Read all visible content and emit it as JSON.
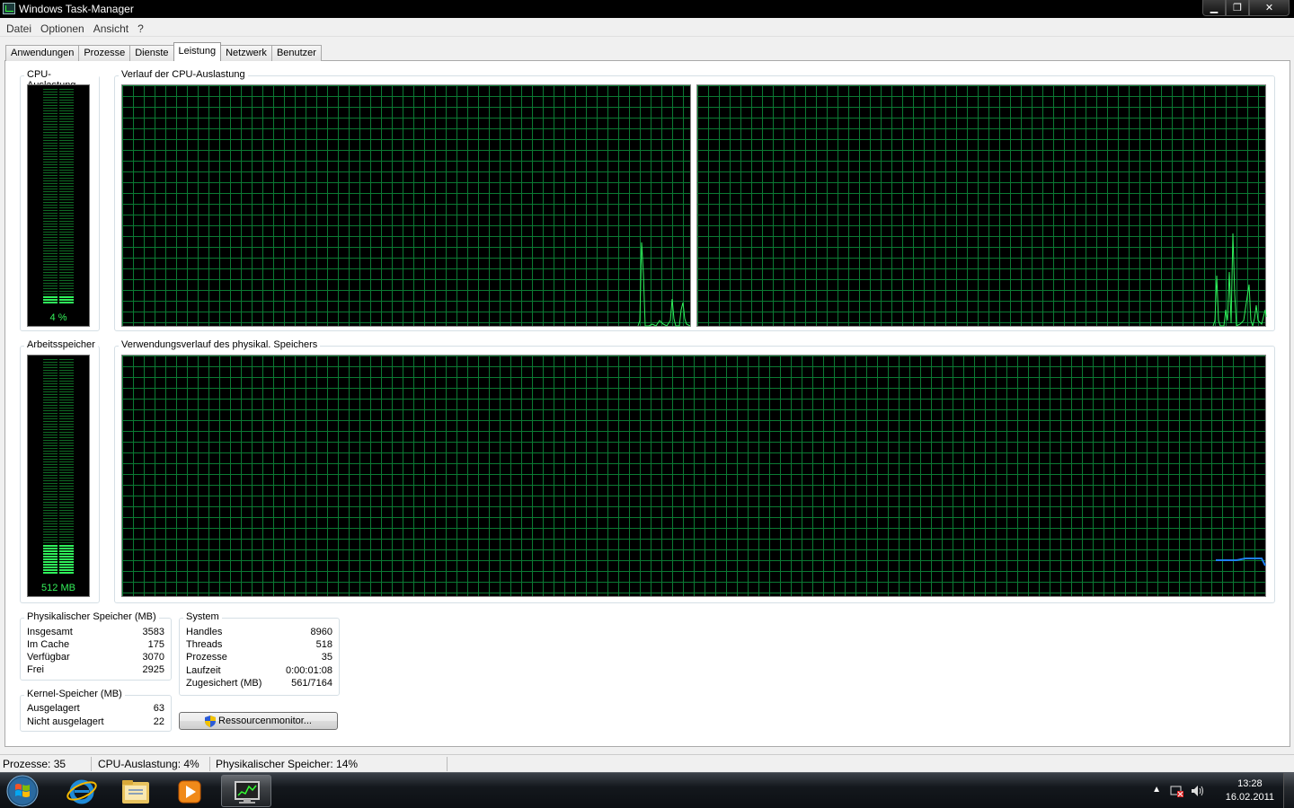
{
  "window": {
    "title": "Windows Task-Manager",
    "minimize_glyph": "▁",
    "maximize_glyph": "❐",
    "close_glyph": "✕"
  },
  "menu": [
    "Datei",
    "Optionen",
    "Ansicht",
    "?"
  ],
  "tabs": [
    {
      "label": "Anwendungen",
      "active": false
    },
    {
      "label": "Prozesse",
      "active": false
    },
    {
      "label": "Dienste",
      "active": false
    },
    {
      "label": "Leistung",
      "active": true
    },
    {
      "label": "Netzwerk",
      "active": false
    },
    {
      "label": "Benutzer",
      "active": false
    }
  ],
  "cpu": {
    "group_label": "CPU-Auslastung",
    "meter_text": "4 %",
    "usage_percent": 4,
    "history_label": "Verlauf der CPU-Auslastung"
  },
  "memory": {
    "group_label": "Arbeitsspeicher",
    "meter_text": "512 MB",
    "usage_percent": 14,
    "history_label": "Verwendungsverlauf des physikal. Speichers"
  },
  "physical_memory": {
    "label": "Physikalischer Speicher (MB)",
    "rows": [
      {
        "name": "Insgesamt",
        "value": "3583"
      },
      {
        "name": "Im Cache",
        "value": "175"
      },
      {
        "name": "Verfügbar",
        "value": "3070"
      },
      {
        "name": "Frei",
        "value": "2925"
      }
    ]
  },
  "kernel_memory": {
    "label": "Kernel-Speicher (MB)",
    "rows": [
      {
        "name": "Ausgelagert",
        "value": "63"
      },
      {
        "name": "Nicht ausgelagert",
        "value": "22"
      }
    ]
  },
  "system": {
    "label": "System",
    "rows": [
      {
        "name": "Handles",
        "value": "8960"
      },
      {
        "name": "Threads",
        "value": "518"
      },
      {
        "name": "Prozesse",
        "value": "35"
      },
      {
        "name": "Laufzeit",
        "value": "0:00:01:08"
      },
      {
        "name": "Zugesichert (MB)",
        "value": "561/7164"
      }
    ]
  },
  "resource_monitor_button": "Ressourcenmonitor...",
  "status": {
    "processes": "Prozesse: 35",
    "cpu": "CPU-Auslastung: 4%",
    "memory": "Physikalischer Speicher: 14%"
  },
  "taskbar": {
    "clock_time": "13:28",
    "clock_date": "16.02.2011"
  },
  "colors": {
    "graph_line": "#2ff05a",
    "memory_line": "#1e7ff0",
    "grid": "#0b7a33"
  }
}
